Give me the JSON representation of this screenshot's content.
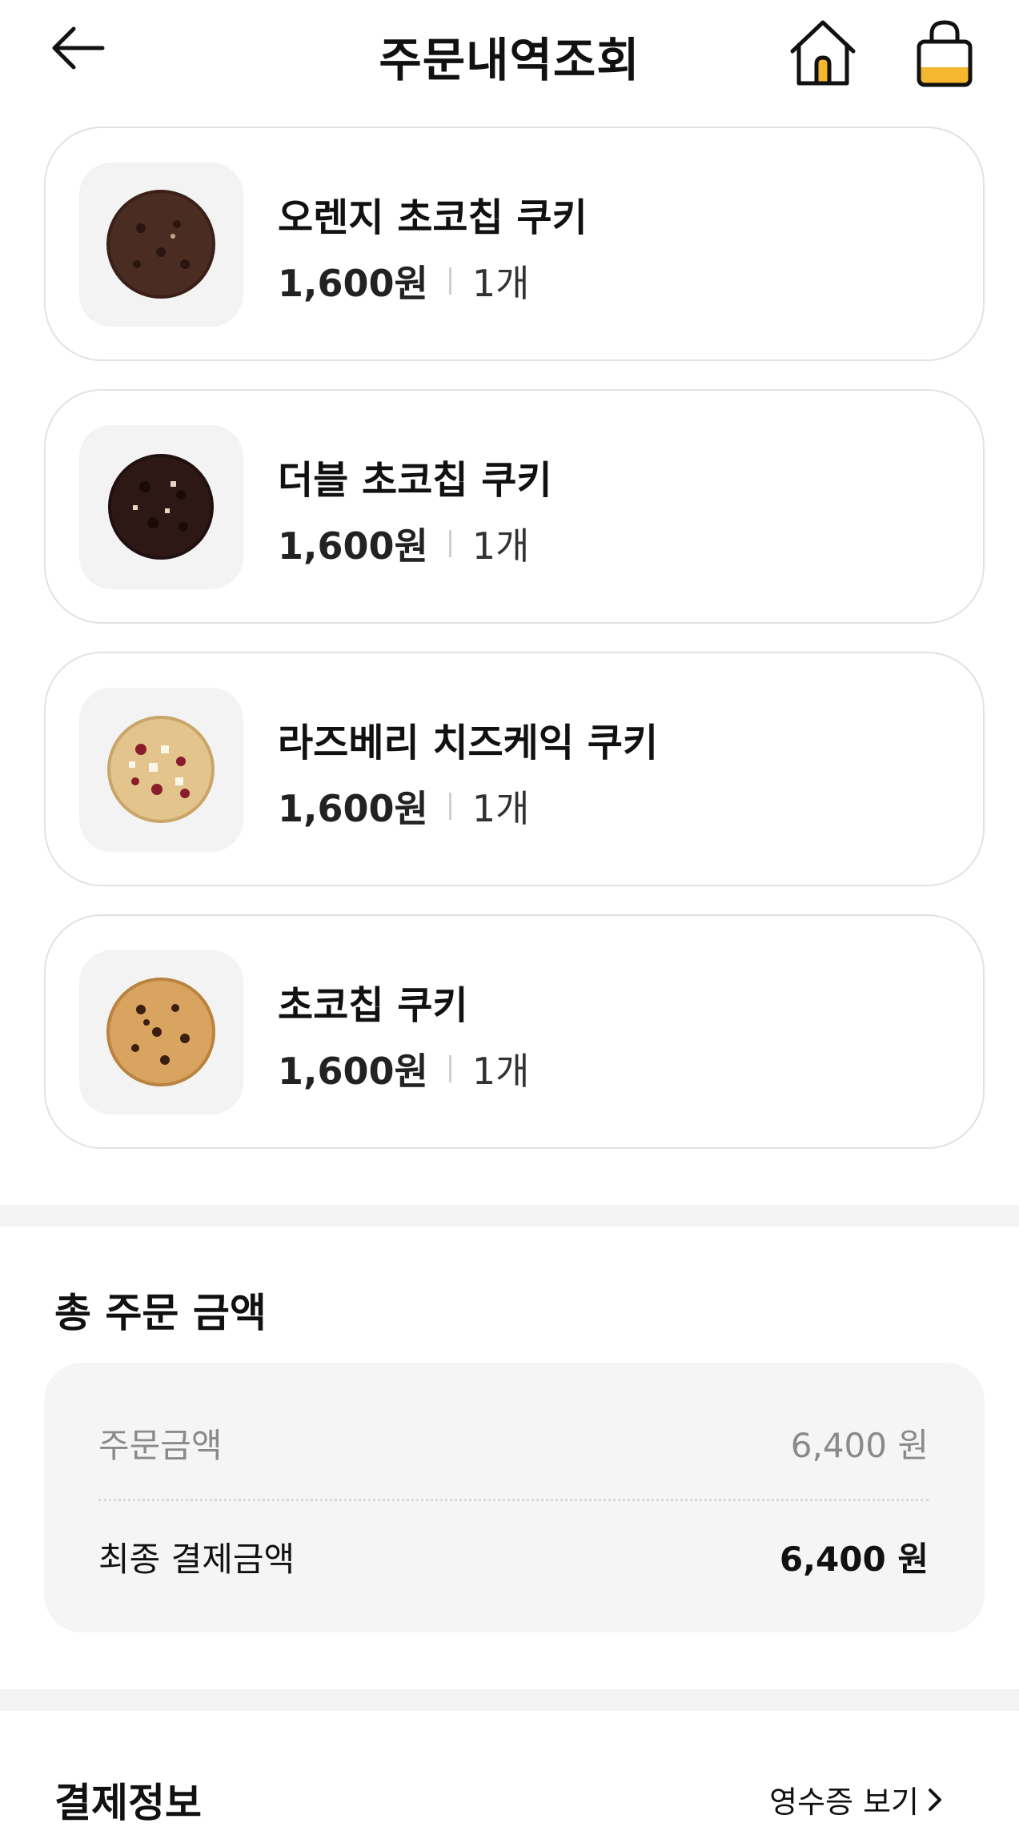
{
  "header": {
    "title": "주문내역조회",
    "back_icon": "arrow-left-icon",
    "home_icon": "home-icon",
    "cart_icon": "shopping-bag-icon",
    "accent": "#F5B730"
  },
  "items": [
    {
      "name": "오렌지 초코칩 쿠키",
      "price": "1,600원",
      "qty": "1개"
    },
    {
      "name": "더블 초코칩 쿠키",
      "price": "1,600원",
      "qty": "1개"
    },
    {
      "name": "라즈베리 치즈케익 쿠키",
      "price": "1,600원",
      "qty": "1개"
    },
    {
      "name": "초코칩 쿠키",
      "price": "1,600원",
      "qty": "1개"
    }
  ],
  "total": {
    "title": "총 주문 금액",
    "order_amount_label": "주문금액",
    "order_amount_value": "6,400 원",
    "final_amount_label": "최종 결제금액",
    "final_amount_value": "6,400 원"
  },
  "payment": {
    "title": "결제정보",
    "receipt_link": "영수증 보기"
  }
}
